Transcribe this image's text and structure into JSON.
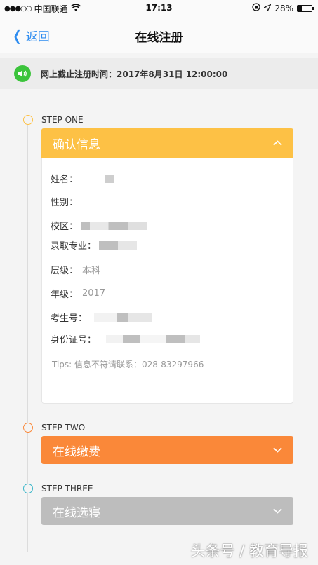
{
  "status_bar": {
    "carrier": "中国联通",
    "time": "17:13",
    "battery": "28%",
    "signal_dots": "●●●○○"
  },
  "nav": {
    "back_label": "返回",
    "title": "在线注册"
  },
  "deadline": {
    "text": "网上截止注册时间：2017年8月31日 12:00:00"
  },
  "steps": [
    {
      "label": "STEP ONE",
      "title": "确认信息",
      "color": "#fdc145",
      "expanded": true
    },
    {
      "label": "STEP TWO",
      "title": "在线缴费",
      "color": "#fa8839",
      "expanded": false
    },
    {
      "label": "STEP THREE",
      "title": "在线选寝",
      "color": "#bdbdbd",
      "expanded": false
    }
  ],
  "info": {
    "name_label": "姓名：",
    "gender_label": "性别：",
    "campus_label": "校区：",
    "major_label": "录取专业：",
    "level_label": "层级：",
    "level_value": "本科",
    "grade_label": "年级：",
    "grade_value": "2017",
    "exam_no_label": "考生号：",
    "id_label": "身份证号：",
    "tips": "Tips: 信息不符请联系：028-83297966"
  },
  "watermark": "头条号 / 教育导报"
}
